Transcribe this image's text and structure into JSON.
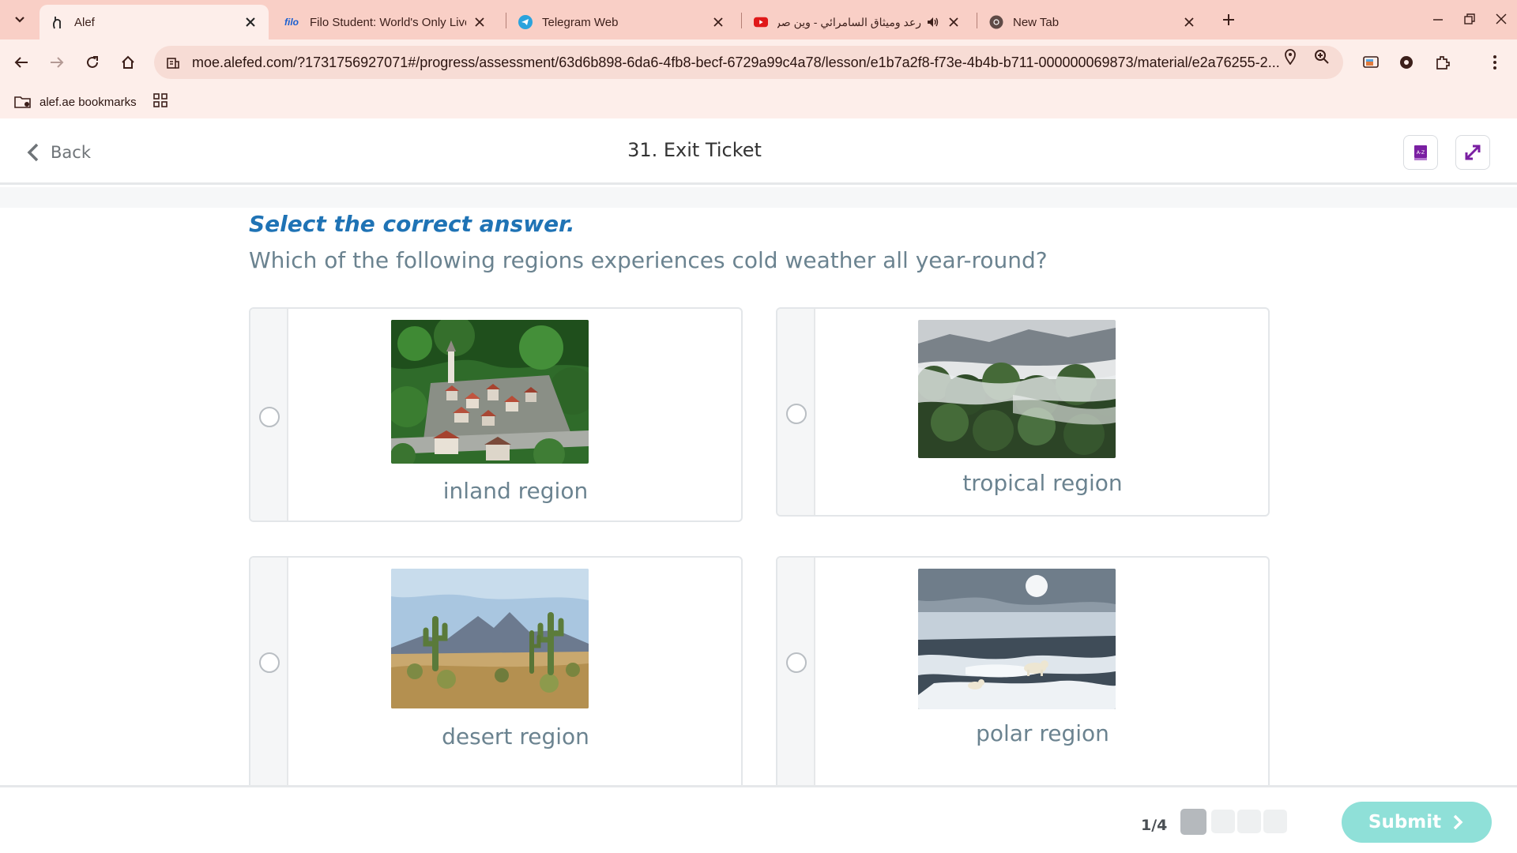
{
  "browser": {
    "tabs": [
      {
        "title": "Alef",
        "icon": "alef-icon"
      },
      {
        "title": "Filo Student: World's Only Live I",
        "icon": "filo-icon",
        "favicon_text": "filo"
      },
      {
        "title": "Telegram Web",
        "icon": "telegram-icon"
      },
      {
        "title": "رعد وميثاق السامرائي - وين صر",
        "icon": "youtube-icon"
      },
      {
        "title": "New Tab",
        "icon": "chrome-icon"
      }
    ],
    "url": "moe.alefed.com/?1731756927071#/progress/assessment/63d6b898-6da6-4fb8-becf-6729a99c4a78/lesson/e1b7a2f8-f73e-4b4b-b711-000000069873/material/e2a76255-2...",
    "bookmark": "alef.ae bookmarks"
  },
  "header": {
    "back_label": "Back",
    "title": "31. Exit Ticket"
  },
  "question": {
    "instruction": "Select the correct answer.",
    "text": "Which of the following regions experiences cold weather all year-round?",
    "options": [
      {
        "label": "inland region",
        "image": "village-in-green-mountains"
      },
      {
        "label": "tropical region",
        "image": "misty-rainforest"
      },
      {
        "label": "desert region",
        "image": "desert-with-saguaro-cacti"
      },
      {
        "label": "polar region",
        "image": "polar-bears-on-sea-ice"
      }
    ]
  },
  "footer": {
    "pager": "1/4",
    "submit_label": "Submit"
  },
  "colors": {
    "tabstrip": "#f9cfc6",
    "toolbar": "#fdeeea",
    "instruction": "#1f73b5",
    "question_text": "#6b8390",
    "submit": "#8fe0d8",
    "header_icon_accent": "#7a1fa2"
  }
}
